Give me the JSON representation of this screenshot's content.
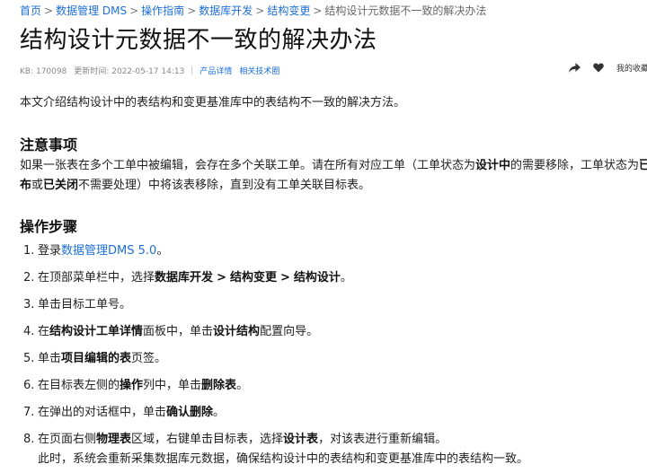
{
  "breadcrumb": {
    "items": [
      "首页",
      "数据管理 DMS",
      "操作指南",
      "数据库开发",
      "结构变更"
    ],
    "current": "结构设计元数据不一致的解决办法",
    "sep": ">"
  },
  "title": "结构设计元数据不一致的解决办法",
  "meta": {
    "kb": "KB: 170098",
    "updated": "更新时间: 2022-05-17 14:13",
    "link1": "产品详情",
    "link2": "相关技术圈",
    "feedback": "我的收藏"
  },
  "intro": "本文介绍结构设计中的表结构和变更基准库中的表结构不一致的解决方法。",
  "notes": {
    "heading": "注意事项",
    "l1_a": "如果一张表在多个工单中被编辑，会存在多个关联工单。请在所有对应工单（工单状态为",
    "l1_b": "设计中",
    "l1_c": "的需要移除，工单状态为",
    "l1_d": "已发",
    "l2_a": "布",
    "l2_b": "或",
    "l2_c": "已关闭",
    "l2_d": "不需要处理）中将该表移除，直到没有工单关联目标表。"
  },
  "steps": {
    "heading": "操作步骤",
    "s1": {
      "num": "1.",
      "a": "登录",
      "link": "数据管理DMS 5.0",
      "b": "。"
    },
    "s2": {
      "num": "2.",
      "a": "在顶部菜单栏中，选择",
      "b1": "数据库开发",
      "gt": ">",
      "b2": "结构变更",
      "b3": "结构设计",
      "c": "。"
    },
    "s3": {
      "num": "3.",
      "a": "单击目标工单号。"
    },
    "s4": {
      "num": "4.",
      "a": "在",
      "b1": "结构设计工单详情",
      "c": "面板中，单击",
      "b2": "设计结构",
      "d": "配置向导。"
    },
    "s5": {
      "num": "5.",
      "a": "单击",
      "b1": "项目编辑的表",
      "c": "页签。"
    },
    "s6": {
      "num": "6.",
      "a": "在目标表左侧的",
      "b1": "操作",
      "c": "列中，单击",
      "b2": "删除表",
      "d": "。"
    },
    "s7": {
      "num": "7.",
      "a": "在弹出的对话框中，单击",
      "b1": "确认删除",
      "c": "。"
    },
    "s8": {
      "num": "8.",
      "a": "在页面右侧",
      "b1": "物理表",
      "c": "区域，右键单击目标表，选择",
      "b2": "设计表",
      "d": "，对该表进行重新编辑。",
      "sub": "此时，系统会重新采集数据库元数据，确保结构设计中的表结构和变更基准库中的表结构一致。"
    }
  },
  "icons": {
    "share": "share-icon",
    "like": "heart-icon"
  },
  "colors": {
    "link": "#1e6fd6"
  }
}
